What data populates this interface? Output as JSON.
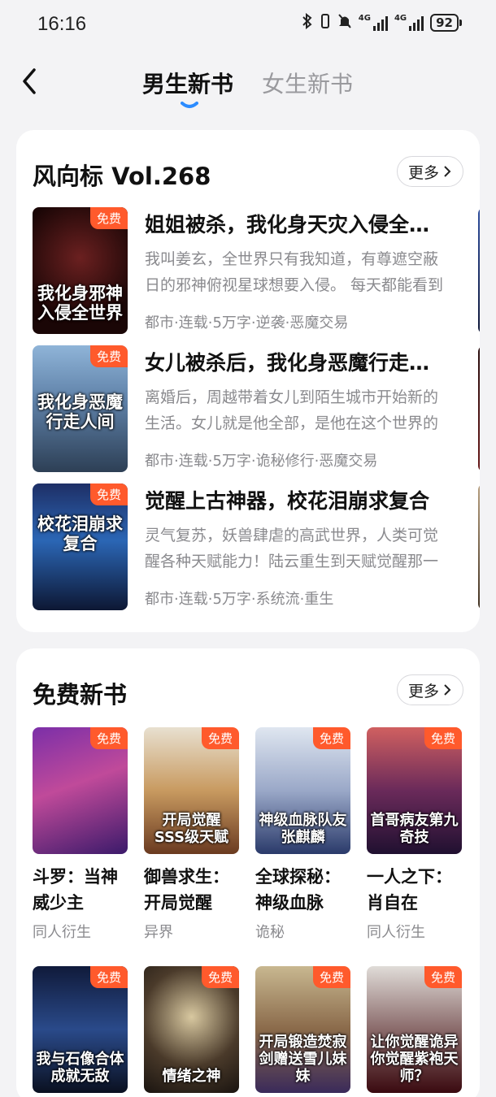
{
  "status": {
    "time": "16:16",
    "signal_label_1": "4G",
    "signal_label_2": "4G",
    "battery": "92"
  },
  "header": {
    "tab_active": "男生新书",
    "tab_inactive": "女生新书"
  },
  "colors": {
    "accent": "#2c8cff",
    "free_tag": "#ff5a2c",
    "muted": "#8a8a8e"
  },
  "section1": {
    "title": "风向标 Vol.268",
    "more": "更多",
    "books": [
      {
        "cover_text": "我化身邪神入侵全世界",
        "badge": "免费",
        "title": "姐姐被杀，我化身天灾入侵全世界",
        "desc": "我叫姜玄，全世界只有我知道，有尊遮空蔽日的邪神俯视星球想要入侵。 每天都能看到它，我都快疯了",
        "tags": "都市·连载·5万字·逆袭·恶魔交易"
      },
      {
        "cover_text": "我化身恶魔行走人间",
        "badge": "免费",
        "title": "女儿被杀后，我化身恶魔行走人间",
        "desc": "离婚后，周越带着女儿到陌生城市开始新的生活。女儿就是他全部，是他在这个世界的一切",
        "tags": "都市·连载·5万字·诡秘修行·恶魔交易"
      },
      {
        "cover_text": "校花泪崩求复合",
        "badge": "免费",
        "title": "觉醒上古神器，校花泪崩求复合",
        "desc": "灵气复苏，妖兽肆虐的高武世界，人类可觉醒各种天赋能力！陆云重生到天赋觉醒那一天",
        "tags": "都市·连载·5万字·系统流·重生"
      }
    ]
  },
  "section2": {
    "title": "免费新书",
    "more": "更多",
    "books": [
      {
        "cover_text": "",
        "badge": "免费",
        "title": "斗罗：当神威少主",
        "genre": "同人衍生"
      },
      {
        "cover_text": "开局觉醒SSS级天赋",
        "badge": "免费",
        "title": "御兽求生：开局觉醒",
        "genre": "异界"
      },
      {
        "cover_text": "神级血脉队友张麒麟",
        "badge": "免费",
        "title": "全球探秘：神级血脉",
        "genre": "诡秘"
      },
      {
        "cover_text": "首哥病友第九奇技",
        "badge": "免费",
        "title": "一人之下：肖自在",
        "genre": "同人衍生"
      },
      {
        "cover_text": "我与石像合体成就无敌",
        "badge": "免费",
        "title": "",
        "genre": ""
      },
      {
        "cover_text": "情绪之神",
        "badge": "免费",
        "title": "",
        "genre": ""
      },
      {
        "cover_text": "开局锻造焚寂剑赠送雪儿妹妹",
        "badge": "免费",
        "title": "",
        "genre": ""
      },
      {
        "cover_text": "让你觉醒诡异你觉醒紫袍天师？",
        "badge": "免费",
        "title": "",
        "genre": ""
      }
    ]
  }
}
